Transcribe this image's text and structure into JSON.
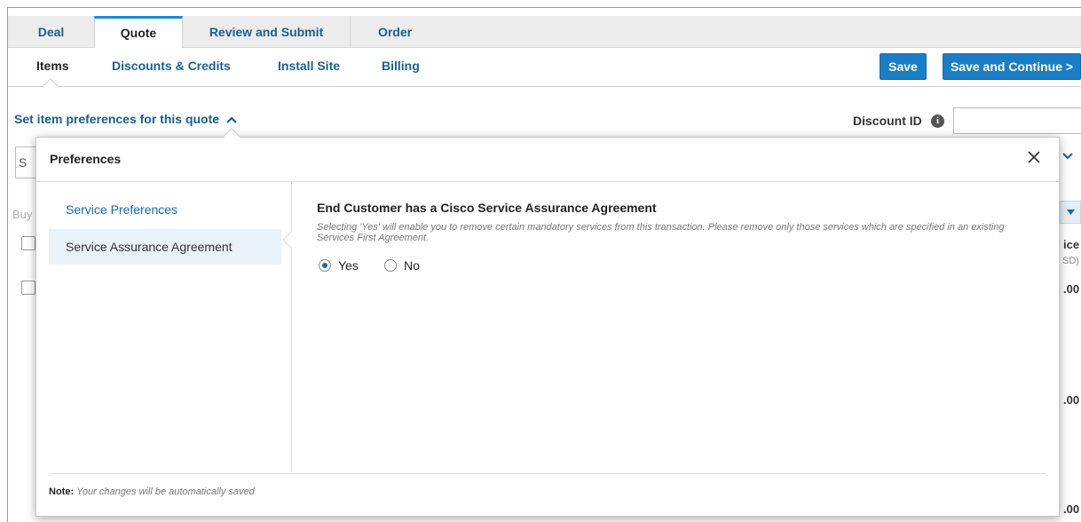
{
  "tabs": [
    {
      "label": "Deal",
      "active": false
    },
    {
      "label": "Quote",
      "active": true
    },
    {
      "label": "Review and Submit",
      "active": false
    },
    {
      "label": "Order",
      "active": false
    }
  ],
  "subnav": [
    {
      "label": "Items",
      "active": true
    },
    {
      "label": "Discounts & Credits",
      "active": false
    },
    {
      "label": "Install Site",
      "active": false
    },
    {
      "label": "Billing",
      "active": false
    }
  ],
  "actions": {
    "save_label": "Save",
    "save_continue_label": "Save and Continue >"
  },
  "preferences_link": {
    "label": "Set item preferences for this quote",
    "chevron_icon": "chevron-up-icon"
  },
  "discount": {
    "label": "Discount ID",
    "info_icon": "info-icon",
    "value": ""
  },
  "background_fragments": {
    "left_s": "S",
    "left_buy": "Buy",
    "col_ice": "ice",
    "col_sd": "SD)",
    "amount_1": ".00",
    "amount_2": ".00",
    "amount_3": ".00"
  },
  "modal": {
    "title": "Preferences",
    "close_icon": "close-icon",
    "sidebar": [
      {
        "label": "Service Preferences",
        "selected": false
      },
      {
        "label": "Service Assurance Agreement",
        "selected": true
      }
    ],
    "content": {
      "heading": "End Customer has a Cisco Service Assurance Agreement",
      "description": "Selecting 'Yes' will enable you to remove certain mandatory services from this transaction. Please remove only those services which are specified in an existing Services First Agreement.",
      "options": [
        {
          "label": "Yes",
          "checked": true
        },
        {
          "label": "No",
          "checked": false
        }
      ]
    },
    "footer": {
      "note_label": "Note:",
      "note_text": "Your changes will be automatically saved"
    }
  },
  "colors": {
    "accent": "#1a7ec4",
    "link": "#1a5f8e",
    "selected_bg": "#e9f2f9"
  }
}
